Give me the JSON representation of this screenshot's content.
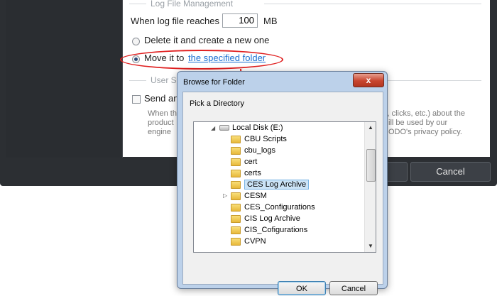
{
  "settings": {
    "log_section_title": "Log File Management",
    "when_log_label": "When log file reaches",
    "log_size_value": "100",
    "log_size_unit": "MB",
    "option_delete_label": "Delete it and create a new one",
    "option_move_label": "Move it to",
    "option_move_link": "the specified folder",
    "user_section_title_partial": "User S",
    "send_label_partial": "Send an",
    "desc_left_lines": [
      "When th",
      "product",
      "engine"
    ],
    "desc_right_lines": [
      "s, clicks, etc.) about the",
      "ill be used by our",
      "ODO's privacy policy."
    ],
    "cancel_label": "Cancel"
  },
  "dialog": {
    "title": "Browse for Folder",
    "close_glyph": "x",
    "prompt": "Pick a Directory",
    "tree_root": "Local Disk (E:)",
    "tree_items": [
      "CBU Scripts",
      "cbu_logs",
      "cert",
      "certs",
      "CES Log Archive",
      "CESM",
      "CES_Configurations",
      "CIS Log Archive",
      "CIS_Cofigurations",
      "CVPN"
    ],
    "selected_item": "CES Log Archive",
    "ok_label": "OK",
    "cancel_label": "Cancel"
  },
  "icons": {
    "folder": "folder-icon",
    "drive": "drive-icon",
    "expand": "expand-arrow-icon",
    "collapse": "collapse-arrow-icon"
  },
  "colors": {
    "link": "#1a6fd1",
    "annotation": "#e02020",
    "dark_panel": "#2c2f33"
  }
}
